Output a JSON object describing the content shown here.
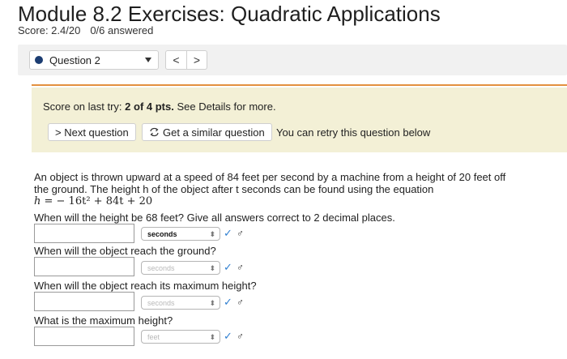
{
  "header": {
    "title": "Module 8.2 Exercises: Quadratic Applications",
    "score": "Score: 2.4/20",
    "answered": "0/6 answered"
  },
  "nav": {
    "question_label": "Question 2",
    "prev": "<",
    "next": ">"
  },
  "feedback": {
    "score_prefix": "Score on last try: ",
    "score_value": "2 of 4 pts.",
    "score_suffix": " See Details for more.",
    "next_question": "> Next question",
    "similar_question": "Get a similar question",
    "retry_text": "You can retry this question below"
  },
  "question": {
    "body": "An object is thrown upward at a speed of 84 feet per second by a machine from a height of 20 feet off the ground. The height h of the object after t seconds can be found using the equation",
    "eq_lhs": "h",
    "eq_rest": " = − 16t² + 84t + 20",
    "instruction": "When will the height be 68 feet? Give all answers correct to 2 decimal places."
  },
  "parts": [
    {
      "prompt": "",
      "value": "",
      "unit": "seconds",
      "unit_active": true
    },
    {
      "prompt": "When will the object reach the ground?",
      "value": "",
      "unit": "seconds",
      "unit_active": false
    },
    {
      "prompt": "When will the object reach its maximum height?",
      "value": "",
      "unit": "seconds",
      "unit_active": false
    },
    {
      "prompt": "What is the maximum height?",
      "value": "",
      "unit": "feet",
      "unit_active": false
    }
  ],
  "icons": {
    "check": "✓",
    "help": "♂",
    "unit_caret": "⬍"
  },
  "colors": {
    "accent_orange": "#e3913f",
    "feedback_bg": "#f3f0d6",
    "check_blue": "#2f7fd0"
  }
}
